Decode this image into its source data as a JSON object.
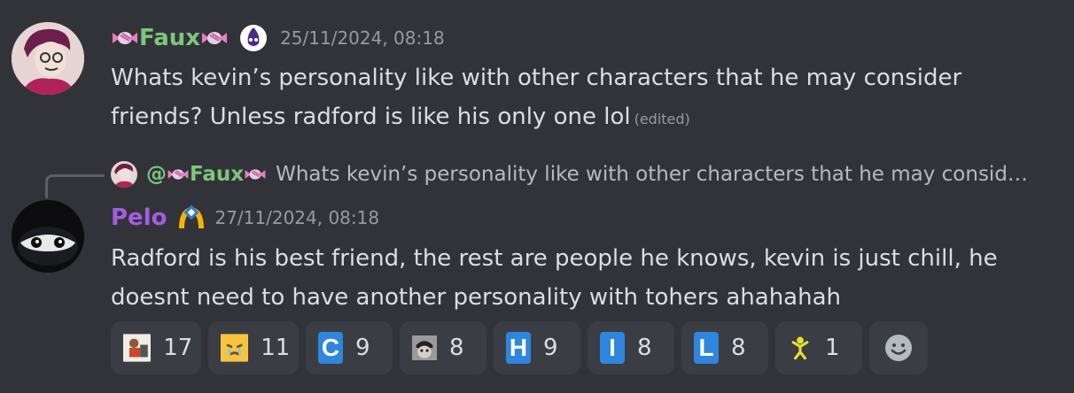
{
  "message1": {
    "username": "Faux",
    "timestamp": "25/11/2024, 08:18",
    "content": "Whats kevin’s personality like with other characters that he may consider friends? Unless radford is like his only one lol",
    "edited_label": "(edited)"
  },
  "reply": {
    "mention": "@",
    "mention_name": "Faux",
    "preview": "Whats kevin’s personality like with other characters that he may consid…"
  },
  "message2": {
    "username": "Pelo",
    "timestamp": "27/11/2024, 08:18",
    "content_line1": "Radford is his best friend, the rest are people he knows, kevin is just chill, he",
    "content_line2": "doesnt need to have another personality with tohers ahahahah"
  },
  "reactions": [
    {
      "emoji": "sketch-emoji",
      "count": "17"
    },
    {
      "emoji": "cry-emoji",
      "count": "11"
    },
    {
      "emoji": "letter-c-emoji",
      "letter": "C",
      "count": "9"
    },
    {
      "emoji": "face-sketch-emoji",
      "count": "8"
    },
    {
      "emoji": "letter-h-emoji",
      "letter": "H",
      "count": "9"
    },
    {
      "emoji": "letter-i-emoji",
      "letter": "I",
      "count": "8"
    },
    {
      "emoji": "letter-l-emoji",
      "letter": "L",
      "count": "8"
    },
    {
      "emoji": "person-emoji",
      "count": "1"
    }
  ],
  "colors": {
    "background": "#323339",
    "faux_name": "#7cc67b",
    "pelo_name": "#a35ee0",
    "letter_emoji": "#2e86de"
  }
}
